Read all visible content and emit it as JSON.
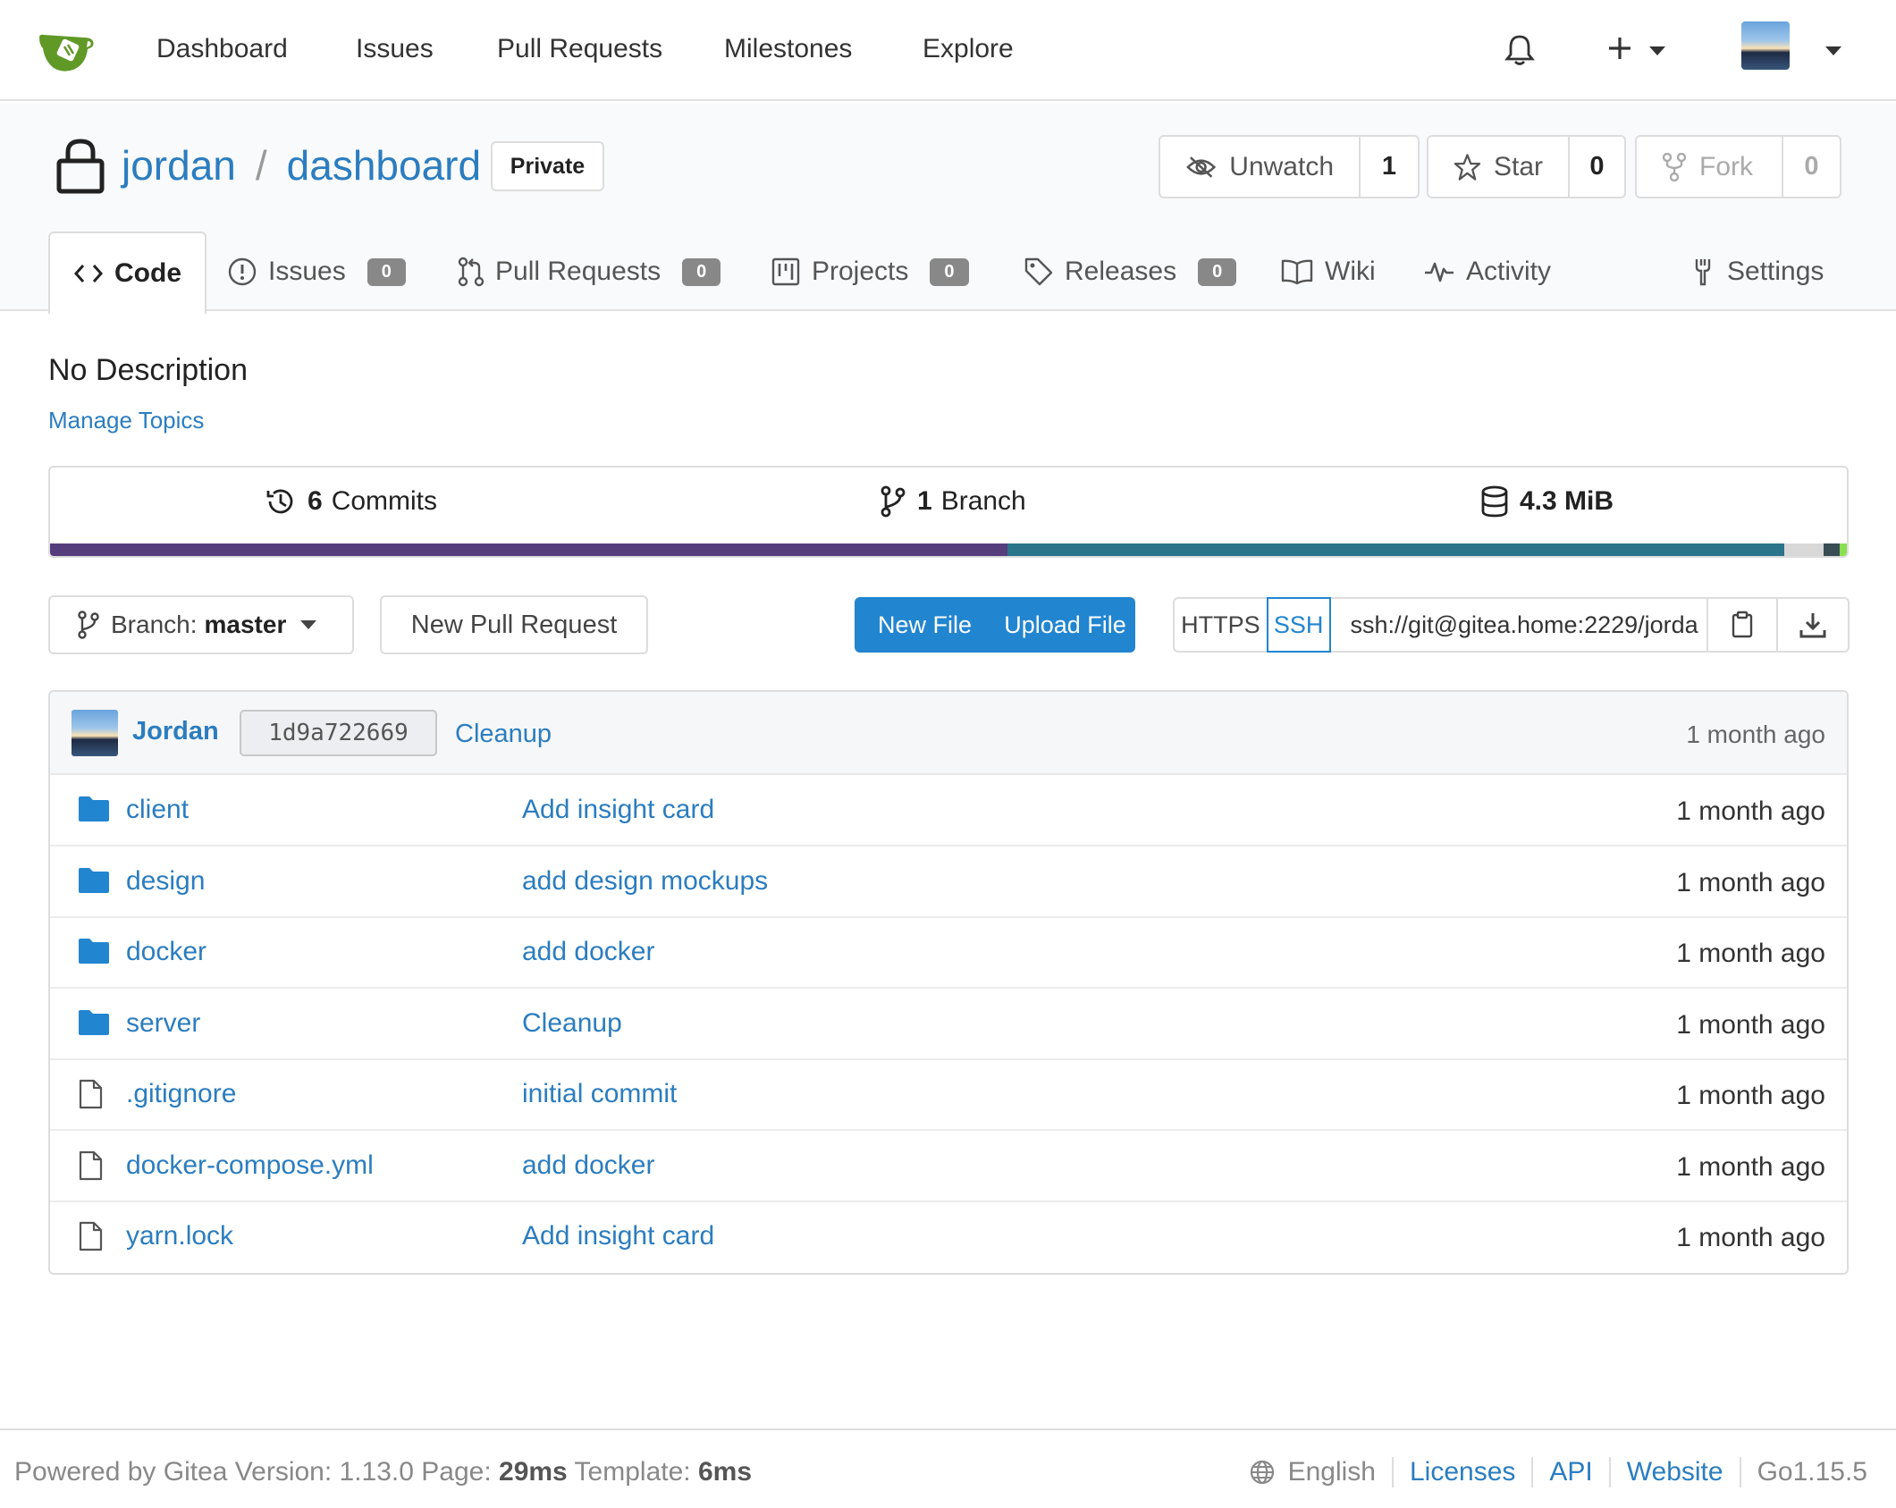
{
  "navbar": {
    "links": [
      "Dashboard",
      "Issues",
      "Pull Requests",
      "Milestones",
      "Explore"
    ]
  },
  "repo": {
    "owner": "jordan",
    "separator": "/",
    "name": "dashboard",
    "visibility": "Private",
    "watch": {
      "label": "Unwatch",
      "count": "1"
    },
    "star": {
      "label": "Star",
      "count": "0"
    },
    "fork": {
      "label": "Fork",
      "count": "0"
    }
  },
  "tabs": [
    {
      "label": "Code",
      "icon": "code-icon",
      "active": true
    },
    {
      "label": "Issues",
      "icon": "issue-icon",
      "badge": "0"
    },
    {
      "label": "Pull Requests",
      "icon": "pull-request-icon",
      "badge": "0"
    },
    {
      "label": "Projects",
      "icon": "project-icon",
      "badge": "0"
    },
    {
      "label": "Releases",
      "icon": "tag-icon",
      "badge": "0"
    },
    {
      "label": "Wiki",
      "icon": "book-icon"
    },
    {
      "label": "Activity",
      "icon": "pulse-icon"
    },
    {
      "label": "Settings",
      "icon": "tools-icon"
    }
  ],
  "description": "No Description",
  "manage_topics": "Manage Topics",
  "stats": {
    "commits_count": "6",
    "commits_label": "Commits",
    "branch_count": "1",
    "branch_label": "Branch",
    "size": "4.3 MiB"
  },
  "languages": [
    {
      "color": "#563d7c",
      "fraction": 0.533
    },
    {
      "color": "#2b7489",
      "fraction": 0.432
    },
    {
      "color": "#d8d8d8",
      "fraction": 0.022
    },
    {
      "color": "#384d54",
      "fraction": 0.009
    },
    {
      "color": "#89e051",
      "fraction": 0.004
    }
  ],
  "toolbar": {
    "branch_prefix": "Branch:",
    "branch_name": "master",
    "new_pull_request": "New Pull Request",
    "new_file": "New File",
    "upload_file": "Upload File",
    "https": "HTTPS",
    "ssh": "SSH",
    "clone_url": "ssh://git@gitea.home:2229/jorda"
  },
  "latest_commit": {
    "author": "Jordan",
    "sha": "1d9a722669",
    "message": "Cleanup",
    "time": "1 month ago"
  },
  "files": [
    {
      "name": "client",
      "type": "folder",
      "message": "Add insight card",
      "time": "1 month ago"
    },
    {
      "name": "design",
      "type": "folder",
      "message": "add design mockups",
      "time": "1 month ago"
    },
    {
      "name": "docker",
      "type": "folder",
      "message": "add docker",
      "time": "1 month ago"
    },
    {
      "name": "server",
      "type": "folder",
      "message": "Cleanup",
      "time": "1 month ago"
    },
    {
      "name": ".gitignore",
      "type": "file",
      "message": "initial commit",
      "time": "1 month ago"
    },
    {
      "name": "docker-compose.yml",
      "type": "file",
      "message": "add docker",
      "time": "1 month ago"
    },
    {
      "name": "yarn.lock",
      "type": "file",
      "message": "Add insight card",
      "time": "1 month ago"
    }
  ],
  "footer": {
    "powered_by": "Powered by Gitea Version: 1.13.0 Page:",
    "page_time": "29ms",
    "template_label": "Template:",
    "template_time": "6ms",
    "language": "English",
    "links": [
      "Licenses",
      "API",
      "Website"
    ],
    "go_version": "Go1.15.5"
  },
  "colors": {
    "accent": "#2185d0",
    "link": "#2b7dbf",
    "logo": "#609926"
  }
}
